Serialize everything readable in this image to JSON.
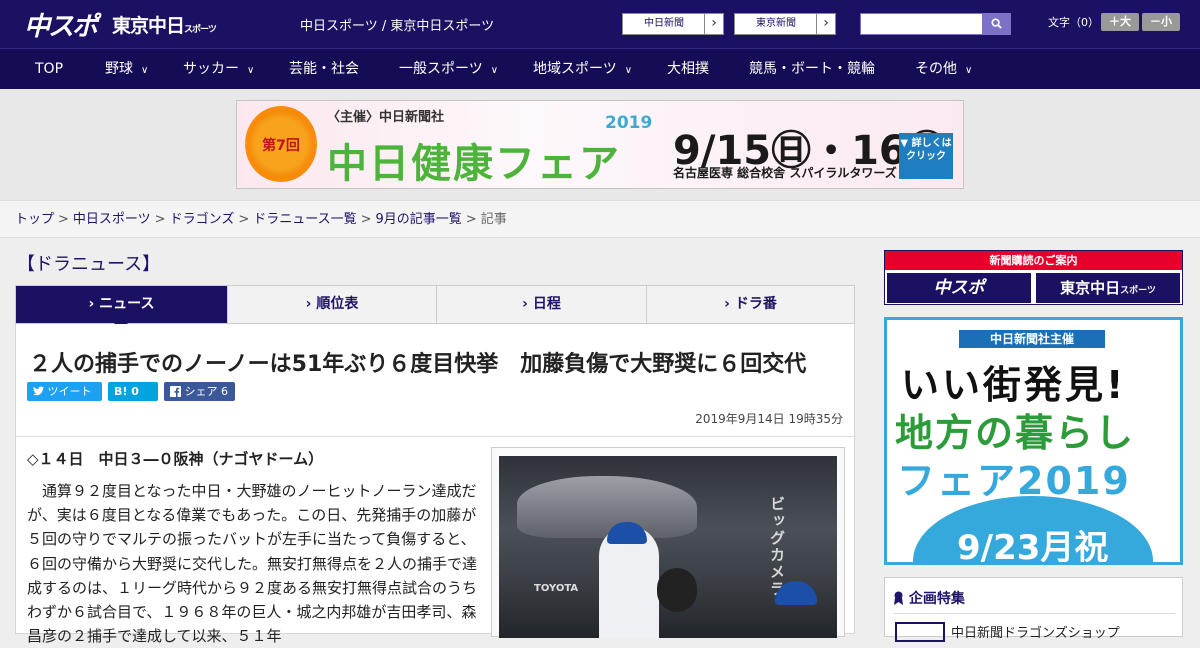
{
  "header": {
    "logo_main": "中スポ",
    "logo_tokyo": "東京中日",
    "logo_tokyo_small": "スポーツ",
    "site_name": "中日スポーツ / 東京中日スポーツ",
    "chunichi_btn": "中日新聞",
    "tokyo_btn": "東京新聞",
    "arrow": "›",
    "search_placeholder": "",
    "search_icon": "search-icon",
    "font_label": "文字（0）",
    "font_plus": "＋大",
    "font_minus": "－小"
  },
  "nav": {
    "items": [
      {
        "label": "TOP",
        "dropdown": ""
      },
      {
        "label": "野球",
        "dropdown": "∨"
      },
      {
        "label": "サッカー",
        "dropdown": "∨"
      },
      {
        "label": "芸能・社会",
        "dropdown": ""
      },
      {
        "label": "一般スポーツ",
        "dropdown": "∨"
      },
      {
        "label": "地域スポーツ",
        "dropdown": "∨"
      },
      {
        "label": "大相撲",
        "dropdown": ""
      },
      {
        "label": "競馬・ボート・競輪",
        "dropdown": ""
      },
      {
        "label": "その他",
        "dropdown": "∨"
      }
    ]
  },
  "banner": {
    "badge": "第7回",
    "organizer": "〈主催〉中日新聞社",
    "title": "中日健康フェア",
    "year": "2019",
    "dates": "9/15㊐・16㊗",
    "venue": "名古屋医専 総合校舎 スパイラルタワーズ",
    "more": "▼ 詳しくは クリック"
  },
  "breadcrumb": {
    "items": [
      "トップ",
      "中日スポーツ",
      "ドラゴンズ",
      "ドラニュース一覧",
      "9月の記事一覧"
    ],
    "current": "記事",
    "sep": ">"
  },
  "section_title": "【ドラニュース】",
  "tabs": [
    {
      "label": "› ニュース"
    },
    {
      "label": "› 順位表"
    },
    {
      "label": "› 日程"
    },
    {
      "label": "› ドラ番"
    }
  ],
  "article": {
    "headline": "２人の捕手でのノーノーは51年ぶり６度目快挙　加藤負傷で大野奨に６回交代",
    "share": {
      "tweet": "ツイート",
      "hatena": "B! 0",
      "facebook": "シェア 6"
    },
    "date": "2019年9月14日 19時35分",
    "lead": "◇１４日　中日３―０阪神（ナゴヤドーム）",
    "body": "通算９２度目となった中日・大野雄のノーヒットノーラン達成だが、実は６度目となる偉業でもあった。この日、先発捕手の加藤が５回の守りでマルテの振ったバットが左手に当たって負傷すると、６回の守備から大野奨に交代した。無安打無得点を２人の捕手で達成するのは、１リーグ時代から９２度ある無安打無得点試合のうちわずか６試合目で、１９６８年の巨人・城之内邦雄が吉田孝司、森昌彦の２捕手で達成して以来、５１年"
  },
  "sidebar": {
    "subscribe_header": "新聞購読のご案内",
    "subscribe_a": "中スポ",
    "subscribe_b": "東京中日",
    "subscribe_b_small": "スポーツ",
    "ad_tag": "中日新聞社主催",
    "ad_line1": "いい街発見!",
    "ad_line2": "地方の暮らし",
    "ad_line3": "フェア2019",
    "ad_date": "9/23月祝",
    "feature_title": "企画特集",
    "feature_item": "中日新聞ドラゴンズショップ"
  },
  "colors": {
    "brand_navy": "#1a1162",
    "accent_red": "#e8002c",
    "twitter": "#1da1f2",
    "hatena": "#00a4de",
    "facebook": "#3b5998"
  }
}
